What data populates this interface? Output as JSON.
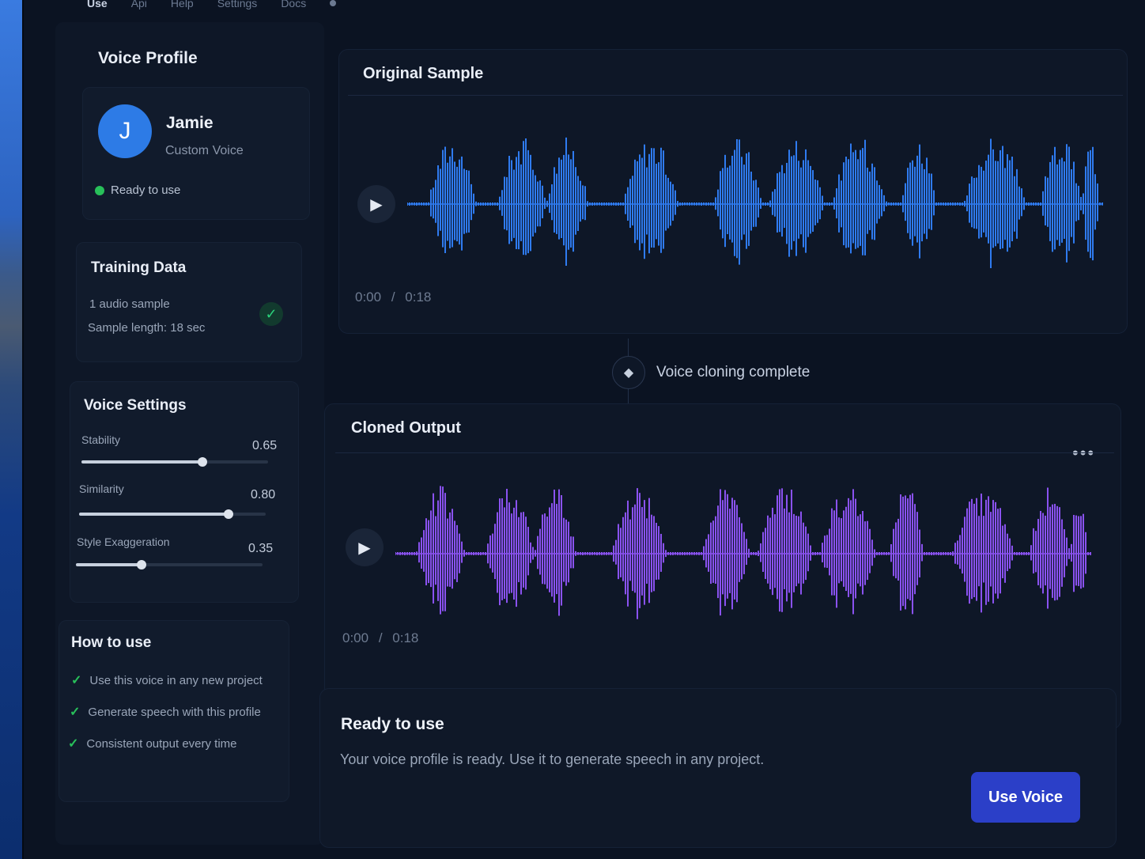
{
  "nav": {
    "items": [
      "Use",
      "Api",
      "Help",
      "Settings",
      "Docs"
    ]
  },
  "sidebar": {
    "title": "Voice Profile",
    "profile": {
      "initial": "J",
      "name": "Jamie",
      "type": "Custom Voice",
      "status": "Ready to use"
    },
    "training": {
      "title": "Training Data",
      "line1": "1 audio sample",
      "line2": "Sample length: 18 sec"
    },
    "settings": {
      "title": "Voice Settings",
      "items": [
        {
          "label": "Stability",
          "value": "0.65",
          "level": 0.65
        },
        {
          "label": "Similarity",
          "value": "0.80",
          "level": 0.8
        },
        {
          "label": "Style Exaggeration",
          "value": "0.35",
          "level": 0.35
        }
      ]
    },
    "howto": {
      "title": "How to use",
      "items": [
        "Use this voice in any new project",
        "Generate speech with this profile",
        "Consistent output every time"
      ]
    }
  },
  "original": {
    "title": "Original Sample",
    "current": "0:00",
    "separator": "/",
    "duration": "0:18",
    "color": "#2f7bf0"
  },
  "status": {
    "text": "Voice cloning complete"
  },
  "cloned": {
    "title": "Cloned Output",
    "current": "0:00",
    "separator": "/",
    "duration": "0:18",
    "color": "#8a52f0"
  },
  "ready": {
    "title": "Ready to use",
    "description": "Your voice profile is ready. Use it to generate speech in any project.",
    "button": "Use Voice"
  },
  "colors": {
    "accent": "#2b3fc8",
    "success": "#28c05a",
    "avatar": "#2d7be6"
  }
}
